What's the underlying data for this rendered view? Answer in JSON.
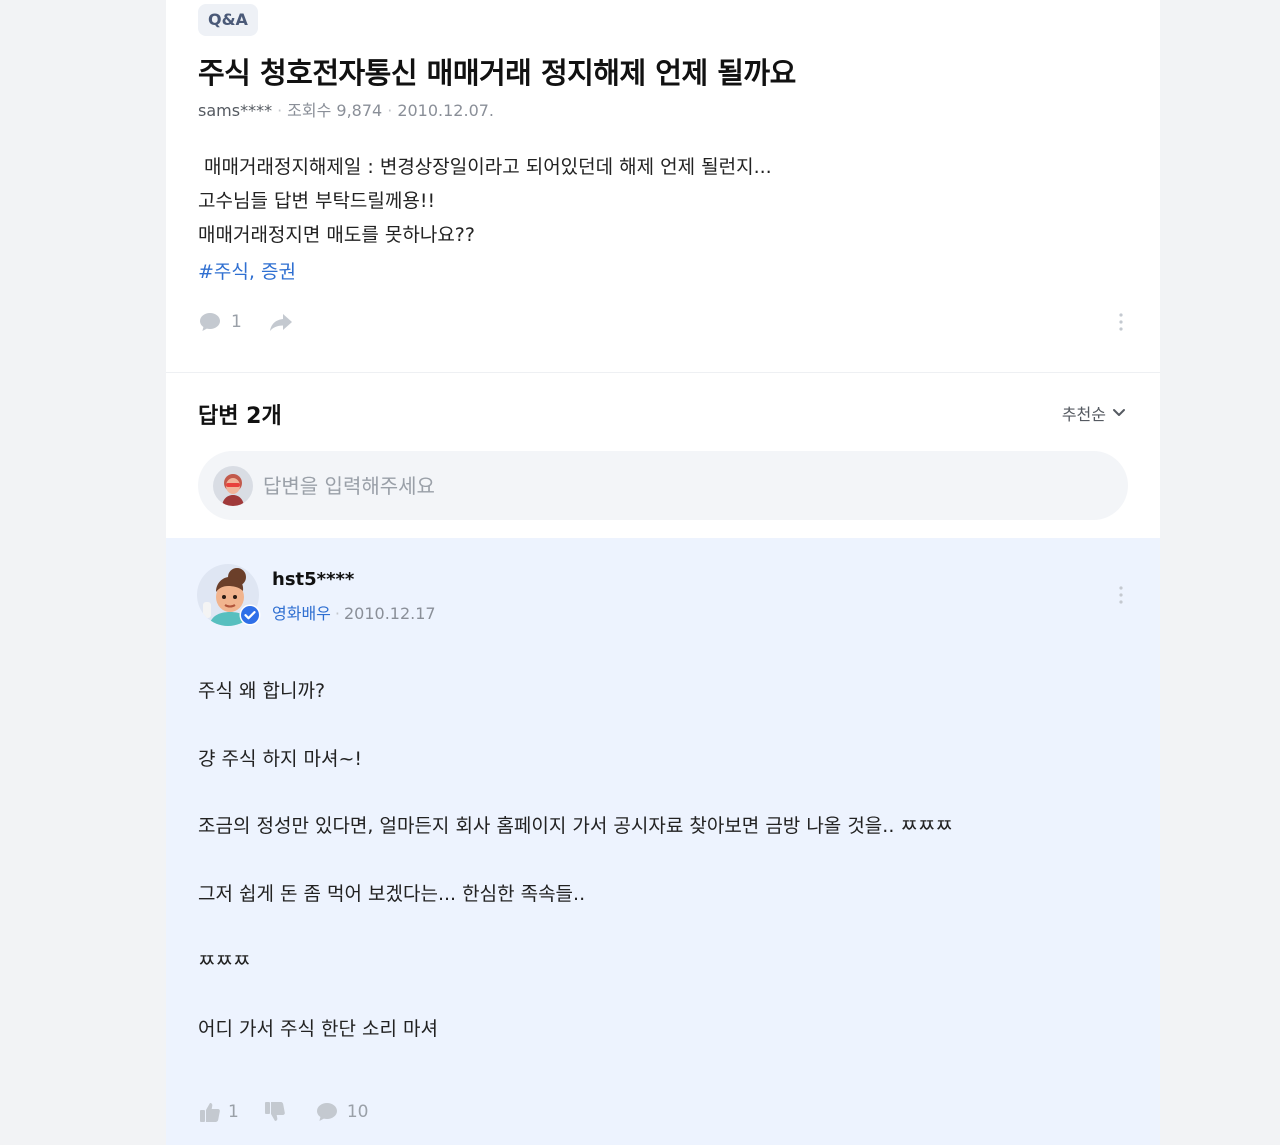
{
  "question": {
    "badge": "Q&A",
    "title": "주식 청호전자통신 매매거래 정지해제 언제 될까요",
    "author": "sams****",
    "views_label": "조회수 9,874",
    "date": "2010.12.07.",
    "body_lines": [
      " 매매거래정지해제일 : 변경상장일이라고 되어있던데 해제 언제 될런지...",
      "고수님들 답변 부탁드릴께용!!",
      "매매거래정지면 매도를 못하나요??"
    ],
    "tags": "#주식, 증권",
    "comment_count": "1",
    "icons": {
      "comment": "comment-icon",
      "share": "share-icon",
      "more": "more-vertical-icon"
    }
  },
  "answers_section": {
    "heading": "답변 2개",
    "sort_label": "추천순",
    "input_placeholder": "답변을 입력해주세요"
  },
  "answer": {
    "user": "hst5****",
    "role": "영화배우",
    "date": "2010.12.17",
    "body_lines": [
      "주식 왜 합니까?",
      "걍 주식 하지 마셔~!",
      "조금의 정성만 있다면, 얼마든지 회사 홈페이지 가서 공시자료 찾아보면 금방 나올 것을.. ㅉㅉㅉ",
      "그저 쉽게 돈 좀 먹어 보겠다는... 한심한 족속들..",
      "ㅉㅉㅉ",
      "어디 가서 주식 한단 소리 마셔"
    ],
    "like_count": "1",
    "comment_count": "10"
  },
  "colors": {
    "accent_blue": "#2f6fd1",
    "answer_bg": "#edf3fe",
    "page_bg": "#f2f3f5"
  }
}
